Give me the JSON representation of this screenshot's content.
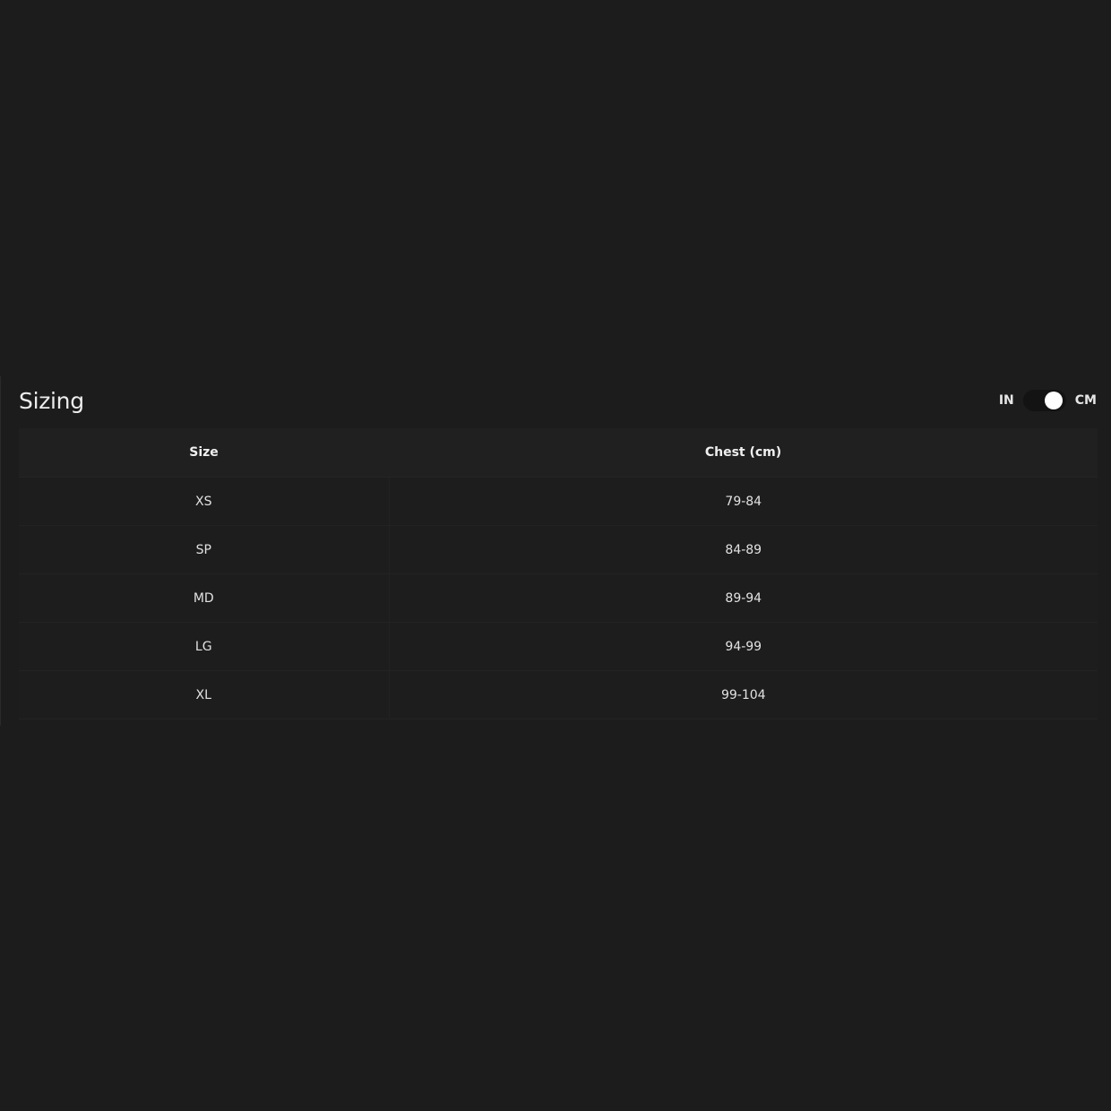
{
  "section": {
    "title": "Sizing"
  },
  "unit_toggle": {
    "left_label": "IN",
    "right_label": "CM",
    "selected": "CM"
  },
  "table": {
    "headers": [
      "Size",
      "Chest (cm)"
    ],
    "rows": [
      [
        "XS",
        "79-84"
      ],
      [
        "SP",
        "84-89"
      ],
      [
        "MD",
        "89-94"
      ],
      [
        "LG",
        "94-99"
      ],
      [
        "XL",
        "99-104"
      ]
    ]
  },
  "colors": {
    "background": "#1c1c1c",
    "header_background": "#202020",
    "text": "#e6e6e6",
    "toggle_track": "#131313",
    "toggle_knob": "#ffffff"
  }
}
